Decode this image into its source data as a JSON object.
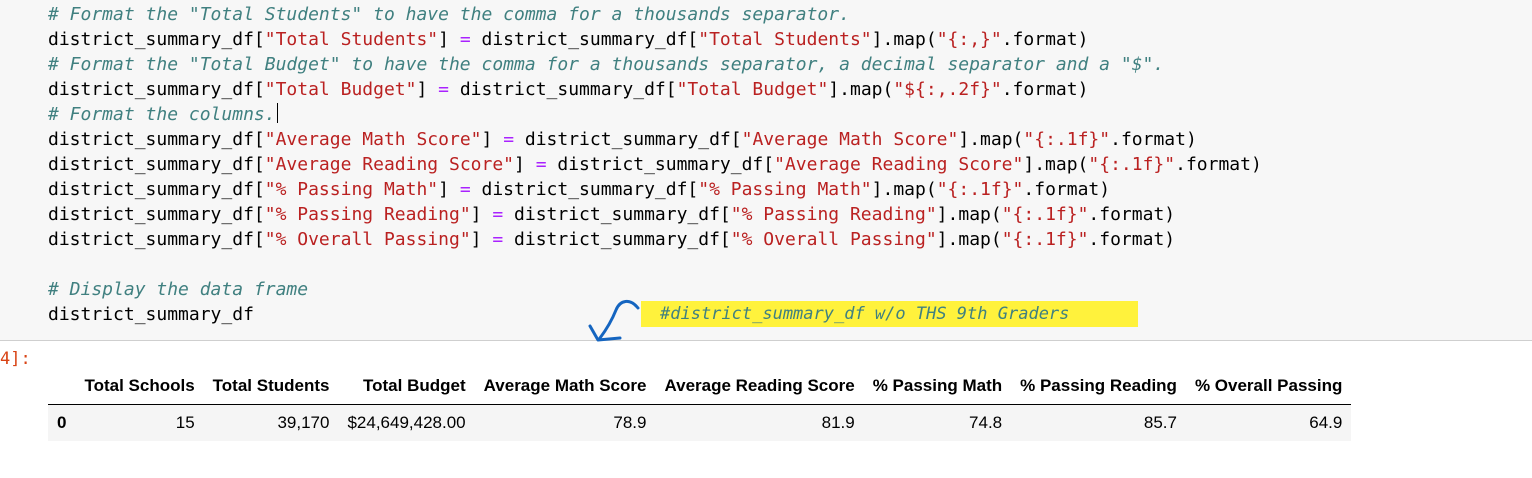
{
  "code_lines": [
    {
      "type": "comment",
      "text": "# Format the \"Total Students\" to have the comma for a thousands separator."
    },
    {
      "type": "code",
      "parts": [
        [
          "plain",
          "district_summary_df["
        ],
        [
          "str",
          "\"Total Students\""
        ],
        [
          "plain",
          "] "
        ],
        [
          "op",
          "="
        ],
        [
          "plain",
          " district_summary_df["
        ],
        [
          "str",
          "\"Total Students\""
        ],
        [
          "plain",
          "]."
        ],
        [
          "plain",
          "map("
        ],
        [
          "str",
          "\"{:,}\""
        ],
        [
          "plain",
          ".format)"
        ]
      ]
    },
    {
      "type": "comment",
      "text": "# Format the \"Total Budget\" to have the comma for a thousands separator, a decimal separator and a \"$\"."
    },
    {
      "type": "code",
      "parts": [
        [
          "plain",
          "district_summary_df["
        ],
        [
          "str",
          "\"Total Budget\""
        ],
        [
          "plain",
          "] "
        ],
        [
          "op",
          "="
        ],
        [
          "plain",
          " district_summary_df["
        ],
        [
          "str",
          "\"Total Budget\""
        ],
        [
          "plain",
          "]."
        ],
        [
          "plain",
          "map("
        ],
        [
          "str",
          "\"${:,.2f}\""
        ],
        [
          "plain",
          ".format)"
        ]
      ]
    },
    {
      "type": "comment",
      "text": "# Format the columns.",
      "caret": true
    },
    {
      "type": "code",
      "parts": [
        [
          "plain",
          "district_summary_df["
        ],
        [
          "str",
          "\"Average Math Score\""
        ],
        [
          "plain",
          "] "
        ],
        [
          "op",
          "="
        ],
        [
          "plain",
          " district_summary_df["
        ],
        [
          "str",
          "\"Average Math Score\""
        ],
        [
          "plain",
          "]."
        ],
        [
          "plain",
          "map("
        ],
        [
          "str",
          "\"{:.1f}\""
        ],
        [
          "plain",
          ".format)"
        ]
      ]
    },
    {
      "type": "code",
      "parts": [
        [
          "plain",
          "district_summary_df["
        ],
        [
          "str",
          "\"Average Reading Score\""
        ],
        [
          "plain",
          "] "
        ],
        [
          "op",
          "="
        ],
        [
          "plain",
          " district_summary_df["
        ],
        [
          "str",
          "\"Average Reading Score\""
        ],
        [
          "plain",
          "]."
        ],
        [
          "plain",
          "map("
        ],
        [
          "str",
          "\"{:.1f}\""
        ],
        [
          "plain",
          ".format)"
        ]
      ]
    },
    {
      "type": "code",
      "parts": [
        [
          "plain",
          "district_summary_df["
        ],
        [
          "str",
          "\"% Passing Math\""
        ],
        [
          "plain",
          "] "
        ],
        [
          "op",
          "="
        ],
        [
          "plain",
          " district_summary_df["
        ],
        [
          "str",
          "\"% Passing Math\""
        ],
        [
          "plain",
          "]."
        ],
        [
          "plain",
          "map("
        ],
        [
          "str",
          "\"{:.1f}\""
        ],
        [
          "plain",
          ".format)"
        ]
      ]
    },
    {
      "type": "code",
      "parts": [
        [
          "plain",
          "district_summary_df["
        ],
        [
          "str",
          "\"% Passing Reading\""
        ],
        [
          "plain",
          "] "
        ],
        [
          "op",
          "="
        ],
        [
          "plain",
          " district_summary_df["
        ],
        [
          "str",
          "\"% Passing Reading\""
        ],
        [
          "plain",
          "]."
        ],
        [
          "plain",
          "map("
        ],
        [
          "str",
          "\"{:.1f}\""
        ],
        [
          "plain",
          ".format)"
        ]
      ]
    },
    {
      "type": "code",
      "parts": [
        [
          "plain",
          "district_summary_df["
        ],
        [
          "str",
          "\"% Overall Passing\""
        ],
        [
          "plain",
          "] "
        ],
        [
          "op",
          "="
        ],
        [
          "plain",
          " district_summary_df["
        ],
        [
          "str",
          "\"% Overall Passing\""
        ],
        [
          "plain",
          "]."
        ],
        [
          "plain",
          "map("
        ],
        [
          "str",
          "\"{:.1f}\""
        ],
        [
          "plain",
          ".format)"
        ]
      ]
    },
    {
      "type": "blank",
      "text": ""
    },
    {
      "type": "comment",
      "text": "# Display the data frame"
    },
    {
      "type": "code",
      "parts": [
        [
          "plain",
          "district_summary_df"
        ]
      ]
    }
  ],
  "annotation": {
    "note": "#district_summary_df w/o THS 9th Graders",
    "highlight_color": "#fff23c",
    "arrow_color": "#1565c0"
  },
  "output": {
    "prompt": "4]:",
    "columns": [
      "",
      "Total Schools",
      "Total Students",
      "Total Budget",
      "Average Math Score",
      "Average Reading Score",
      "% Passing Math",
      "% Passing Reading",
      "% Overall Passing"
    ],
    "rows": [
      [
        "0",
        "15",
        "39,170",
        "$24,649,428.00",
        "78.9",
        "81.9",
        "74.8",
        "85.7",
        "64.9"
      ]
    ]
  },
  "colors": {
    "comment": "#408080",
    "string": "#ba2121",
    "operator": "#aa22ff",
    "prompt": "#d84315"
  }
}
